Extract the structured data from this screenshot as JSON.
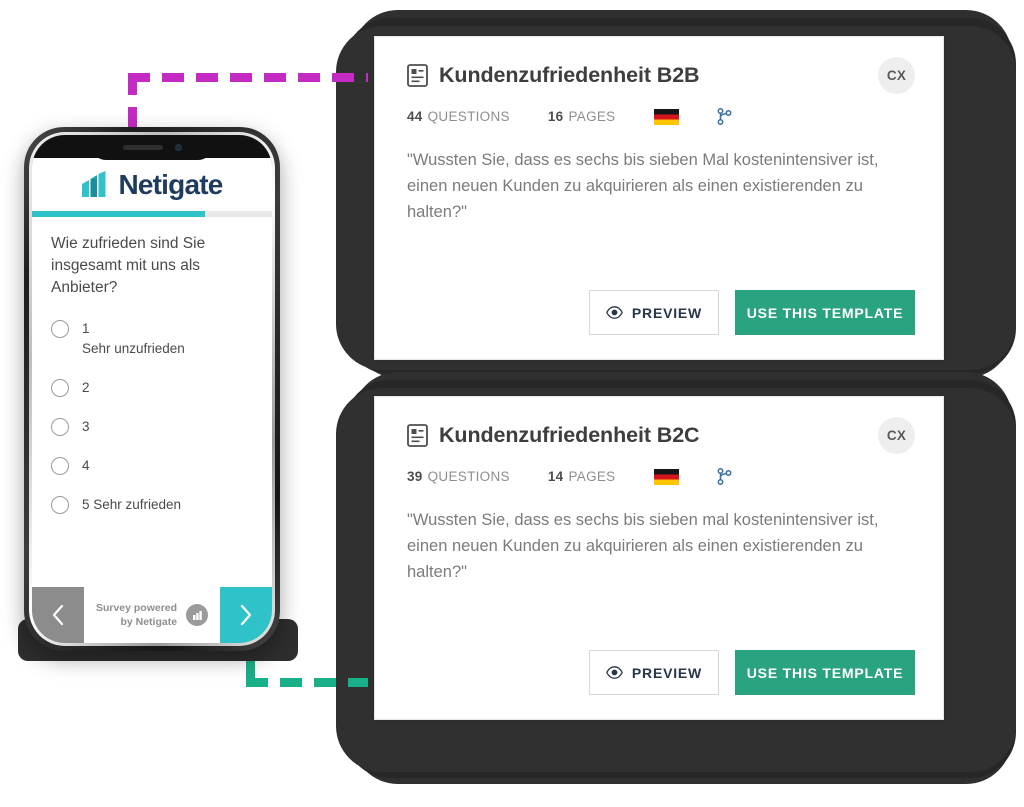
{
  "cards": [
    {
      "title": "Kundenzufriedenheit B2B",
      "badge": "CX",
      "questions_count": "44",
      "questions_label": "QUESTIONS",
      "pages_count": "16",
      "pages_label": "PAGES",
      "language_flag": "germany-flag-icon",
      "branch_icon": "branch-icon",
      "quote": "\"Wussten Sie, dass es sechs bis sieben Mal kostenintensiver ist, einen neuen Kunden zu akquirieren als einen existierenden zu halten?\"",
      "preview_label": "PREVIEW",
      "use_label": "USE THIS TEMPLATE"
    },
    {
      "title": "Kundenzufriedenheit B2C",
      "badge": "CX",
      "questions_count": "39",
      "questions_label": "QUESTIONS",
      "pages_count": "14",
      "pages_label": "PAGES",
      "language_flag": "germany-flag-icon",
      "branch_icon": "branch-icon",
      "quote": "\"Wussten Sie, dass es sechs bis sieben mal kostenintensiver ist, einen neuen Kunden zu akquirieren als einen existierenden zu halten?\"",
      "preview_label": "PREVIEW",
      "use_label": "USE THIS TEMPLATE"
    }
  ],
  "phone": {
    "brand_name": "Netigate",
    "progress_percent": "72",
    "question": "Wie zufrieden sind Sie insgesamt mit uns als Anbieter?",
    "options": [
      {
        "value": "1",
        "label": "1\nSehr unzufrieden"
      },
      {
        "value": "2",
        "label": "2"
      },
      {
        "value": "3",
        "label": "3"
      },
      {
        "value": "4",
        "label": "4"
      },
      {
        "value": "5",
        "label": "5 Sehr zufrieden"
      }
    ],
    "footer": {
      "powered_line1": "Survey powered",
      "powered_line2": "by Netigate",
      "prev_icon": "chevron-left-icon",
      "next_icon": "chevron-right-icon"
    }
  },
  "colors": {
    "teal": "#2fc3c9",
    "green": "#2aa380",
    "navy": "#1f3b5e",
    "magenta_connector": "#c42bc4",
    "green_connector": "#18b089",
    "frame_dark": "#2f2f2f"
  }
}
